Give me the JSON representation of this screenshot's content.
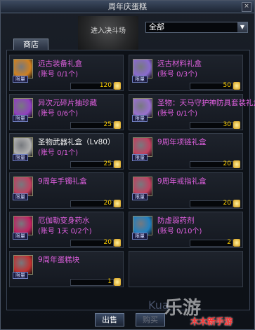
{
  "window": {
    "title": "周年庆蛋糕",
    "close": "×"
  },
  "banner": {
    "text": "进入决斗场"
  },
  "filter": {
    "selected": "全部"
  },
  "tab": {
    "label": "商店"
  },
  "badge": "限量",
  "items": [
    {
      "name": "远古装备礼盒",
      "limit": "(账号 0/1个)",
      "price": "120",
      "icon_color": "#d08020",
      "name_color": "pink"
    },
    {
      "name": "远古材料礼盒",
      "limit": "(账号 0/3个)",
      "price": "50",
      "icon_color": "#8a6ad0",
      "name_color": "pink"
    },
    {
      "name": "异次元碎片抽珍藏",
      "limit": "(账号 0/6个)",
      "price": "25",
      "icon_color": "#9040c0",
      "name_color": "pink"
    },
    {
      "name": "圣物：天马守护神防具套装礼盒",
      "limit": "(账号 0/1个)",
      "price": "30",
      "icon_color": "#9a70d0",
      "name_color": "pink"
    },
    {
      "name": "圣物武器礼盒（Lv80）",
      "limit": "(账号 0/1个)",
      "price": "25",
      "icon_color": "#b0b0b0",
      "name_color": "white"
    },
    {
      "name": "9周年项链礼盒",
      "limit": "",
      "price": "20",
      "icon_color": "#c04060",
      "name_color": "pink"
    },
    {
      "name": "9周年手镯礼盒",
      "limit": "",
      "price": "20",
      "icon_color": "#c04060",
      "name_color": "pink"
    },
    {
      "name": "9周年戒指礼盒",
      "limit": "",
      "price": "20",
      "icon_color": "#c04060",
      "name_color": "pink"
    },
    {
      "name": "厄伽勒变身药水",
      "limit": "(账号 1天 0/2个)",
      "price": "20",
      "icon_color": "#c02060",
      "name_color": "pink"
    },
    {
      "name": "防虚弱药剂",
      "limit": "(账号 0/10个)",
      "price": "2",
      "icon_color": "#2080c0",
      "name_color": "pink"
    },
    {
      "name": "9周年蛋糕块",
      "limit": "",
      "price": "1",
      "icon_color": "#c03030",
      "name_color": "pink"
    }
  ],
  "buttons": {
    "sell": "出售",
    "buy": "购买"
  },
  "watermark": {
    "brand": "Kua",
    "site_big": "乐游",
    "site_red": "木木新手游"
  }
}
